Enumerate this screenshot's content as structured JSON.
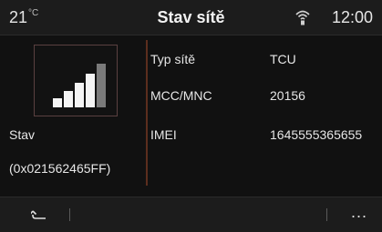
{
  "header": {
    "temperature": "21",
    "temperature_unit": "°C",
    "title": "Stav sítě",
    "status_icon": "signal-broadcast-icon",
    "clock": "12:00"
  },
  "left": {
    "signal_icon": "signal-strength-icon",
    "signal_level": 4,
    "signal_max": 5,
    "status_label": "Stav",
    "status_value": "(0x021562465FF)"
  },
  "info_rows": [
    {
      "label": "Typ sítě",
      "value": "TCU"
    },
    {
      "label": "MCC/MNC",
      "value": "20156"
    },
    {
      "label": "IMEI",
      "value": "1645555365655"
    }
  ],
  "bottom": {
    "back_icon": "back-arrow-icon",
    "more_label": "..."
  }
}
